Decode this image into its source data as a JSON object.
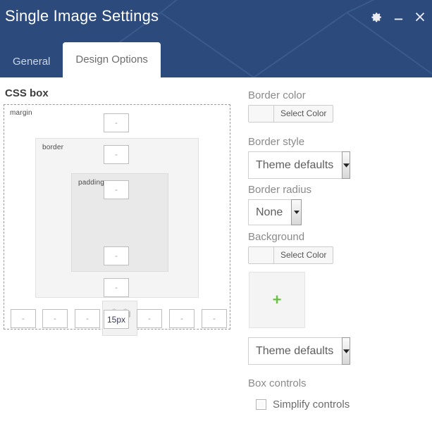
{
  "window": {
    "title": "Single Image Settings",
    "controls": [
      {
        "name": "settings-gear",
        "glyph": "gear-icon"
      },
      {
        "name": "minimize",
        "glyph": "minimize-icon"
      },
      {
        "name": "close",
        "glyph": "close-icon"
      }
    ],
    "header_bg": "#2c4b7c"
  },
  "tabs": [
    {
      "label": "General",
      "active": false
    },
    {
      "label": "Design Options",
      "active": true
    }
  ],
  "css_box": {
    "title": "CSS box",
    "labels": {
      "margin": "margin",
      "border": "border",
      "padding": "padding"
    },
    "content_icon": "css-box-3d-cube-icon",
    "inputs": {
      "margin_top": {
        "value": "",
        "placeholder": "-"
      },
      "margin_right": {
        "value": "",
        "placeholder": "-"
      },
      "margin_bottom": {
        "value": "15px",
        "placeholder": "-"
      },
      "margin_left": {
        "value": "",
        "placeholder": "-"
      },
      "border_top": {
        "value": "",
        "placeholder": "-"
      },
      "border_right": {
        "value": "",
        "placeholder": "-"
      },
      "border_bottom": {
        "value": "",
        "placeholder": "-"
      },
      "border_left": {
        "value": "",
        "placeholder": "-"
      },
      "padding_top": {
        "value": "",
        "placeholder": "-"
      },
      "padding_right": {
        "value": "",
        "placeholder": "-"
      },
      "padding_bottom": {
        "value": "",
        "placeholder": "-"
      },
      "padding_left": {
        "value": "",
        "placeholder": "-"
      }
    }
  },
  "panel": {
    "border_color": {
      "label": "Border color",
      "button_label": "Select Color",
      "swatch": "#f7f7f7"
    },
    "border_style": {
      "label": "Border style",
      "value": "Theme defaults"
    },
    "border_radius": {
      "label": "Border radius",
      "value": "None"
    },
    "background": {
      "label": "Background",
      "button_label": "Select Color",
      "swatch": "#f7f7f7"
    },
    "image_upload": {
      "plus": "+",
      "plus_color": "#6cc04a"
    },
    "background_style": {
      "value": "Theme defaults"
    },
    "box_controls": {
      "label": "Box controls",
      "simplify_label": "Simplify controls",
      "simplify_checked": false
    }
  }
}
